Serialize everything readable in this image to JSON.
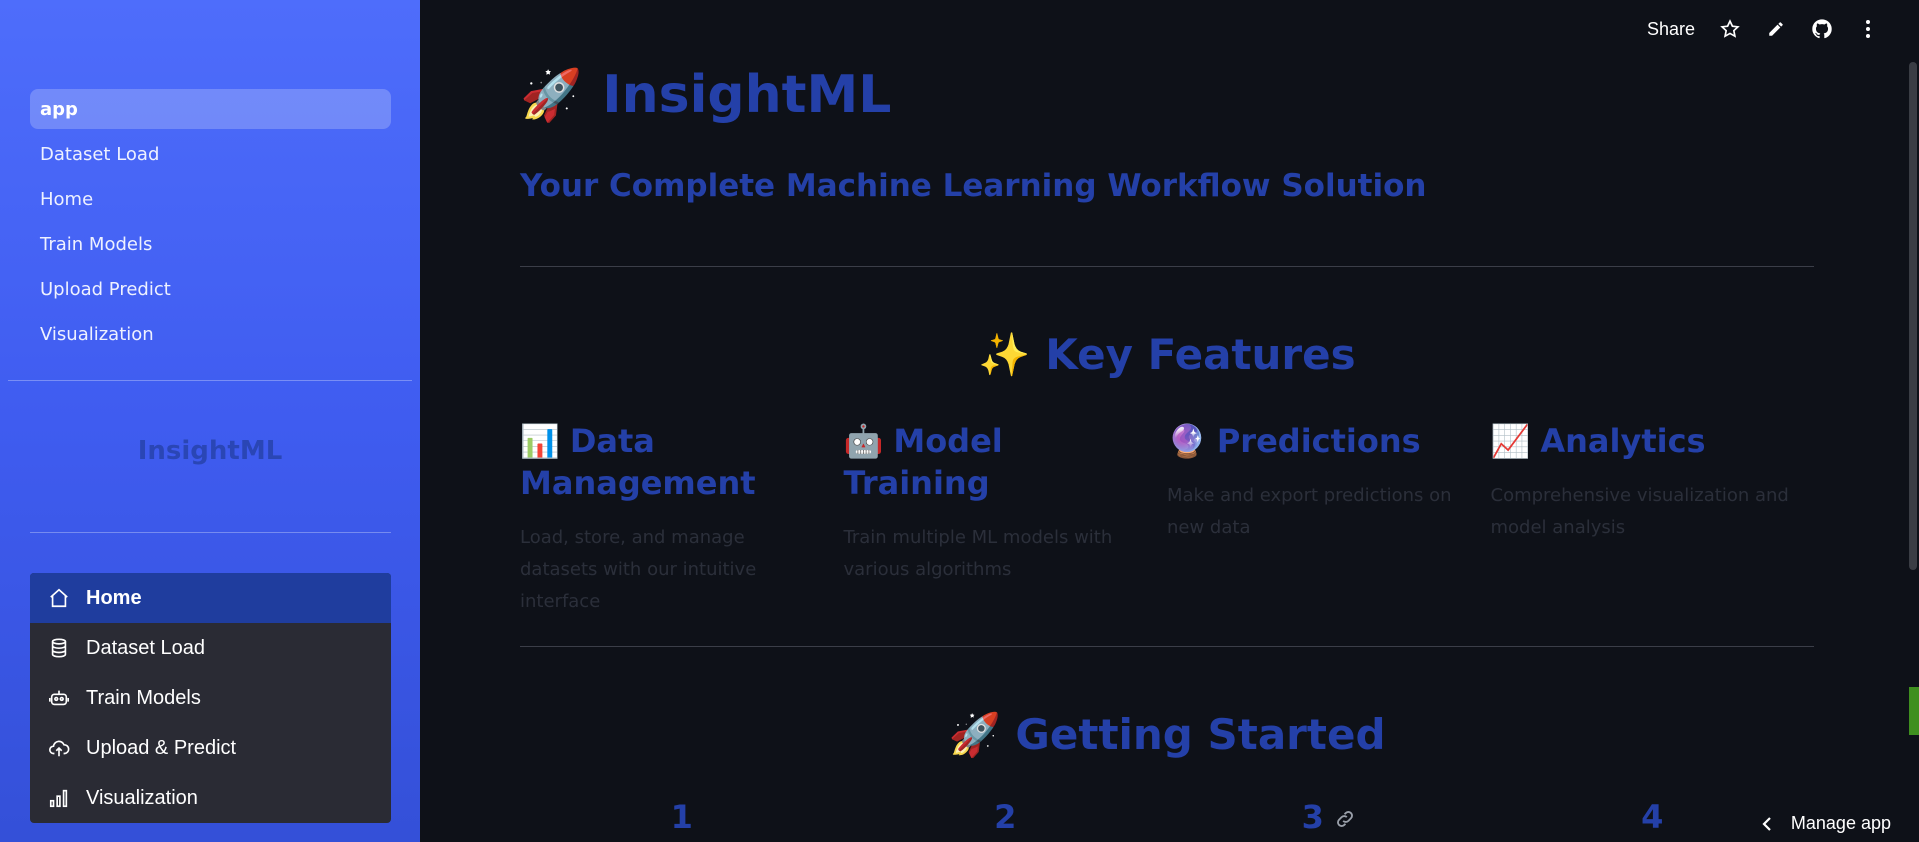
{
  "sidebar": {
    "pages": [
      {
        "label": "app",
        "active": true
      },
      {
        "label": "Dataset Load"
      },
      {
        "label": "Home"
      },
      {
        "label": "Train Models"
      },
      {
        "label": "Upload Predict"
      },
      {
        "label": "Visualization"
      }
    ],
    "brand": "InsightML",
    "menu": [
      {
        "label": "Home",
        "icon": "house-icon",
        "active": true
      },
      {
        "label": "Dataset Load",
        "icon": "database-icon"
      },
      {
        "label": "Train Models",
        "icon": "robot-icon"
      },
      {
        "label": "Upload & Predict",
        "icon": "cloud-upload-icon"
      },
      {
        "label": "Visualization",
        "icon": "bar-chart-icon"
      }
    ]
  },
  "toolbar": {
    "share_label": "Share",
    "icons": [
      "star-icon",
      "pencil-icon",
      "github-icon",
      "more-vertical-icon"
    ]
  },
  "main": {
    "title_emoji": "🚀",
    "title": "InsightML",
    "subtitle": "Your Complete Machine Learning Workflow Solution",
    "features_heading": "✨ Key Features",
    "features": [
      {
        "emoji": "📊",
        "title": "Data Management",
        "desc": "Load, store, and manage datasets with our intuitive interface"
      },
      {
        "emoji": "🤖",
        "title": "Model Training",
        "desc": "Train multiple ML models with various algorithms"
      },
      {
        "emoji": "🔮",
        "title": "Predictions",
        "desc": "Make and export predictions on new data"
      },
      {
        "emoji": "📈",
        "title": "Analytics",
        "desc": "Comprehensive visualization and model analysis"
      }
    ],
    "getting_started_heading": "🚀 Getting Started",
    "steps": [
      "1",
      "2",
      "3",
      "4"
    ]
  },
  "footer": {
    "manage_app": "Manage app"
  },
  "colors": {
    "sidebar_top": "#4e6dfb",
    "sidebar_bottom": "#3450d8",
    "main_bg": "#0e1118",
    "heading": "#2440a8",
    "menu_bg": "#2a2b34",
    "menu_active": "#1f3d9e"
  }
}
